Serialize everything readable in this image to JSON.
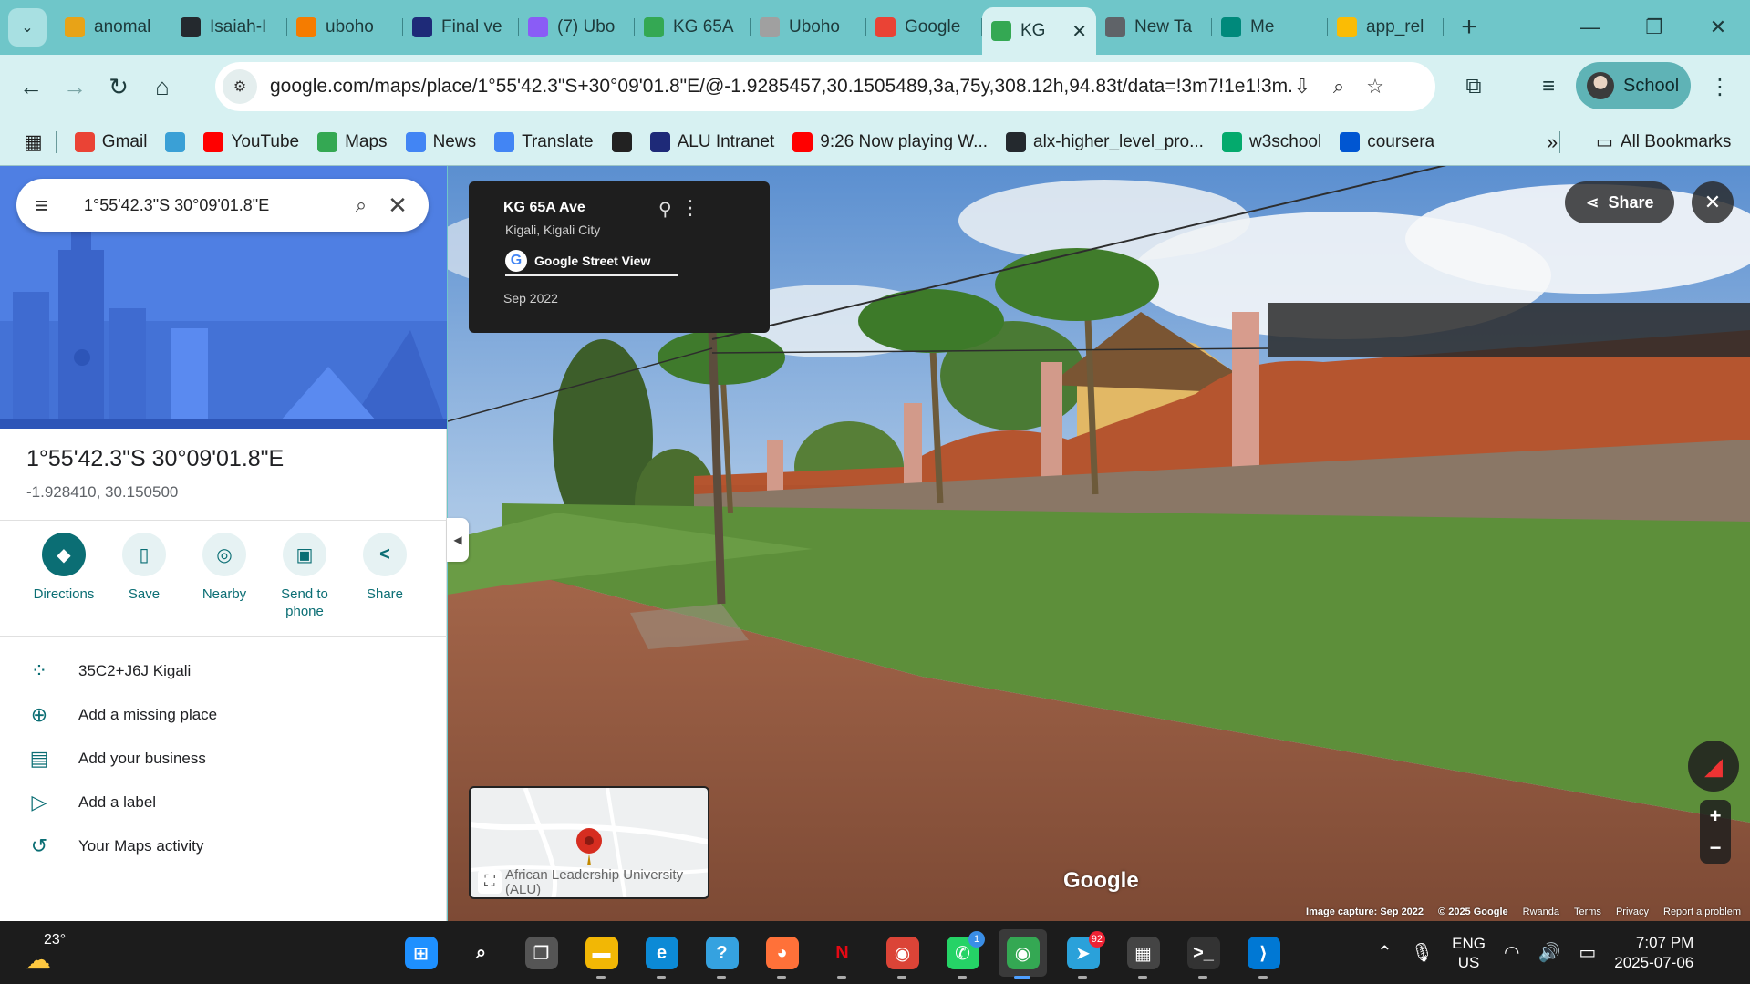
{
  "browser": {
    "tabs": [
      {
        "label": "anomal",
        "icon": "folder-icon",
        "color": "#e8a317"
      },
      {
        "label": "Isaiah-I",
        "icon": "github-icon",
        "color": "#24292e"
      },
      {
        "label": "uboho",
        "icon": "firebase-icon",
        "color": "#f57c00"
      },
      {
        "label": "Final ve",
        "icon": "alu-icon",
        "color": "#1e2a78"
      },
      {
        "label": "(7) Ubo",
        "icon": "vercel-icon",
        "color": "#8a5cf6"
      },
      {
        "label": "KG 65A",
        "icon": "maps-icon",
        "color": "#34a853"
      },
      {
        "label": "Uboho",
        "icon": "loading-icon",
        "color": "#a0a0a0"
      },
      {
        "label": "Google",
        "icon": "gmail-icon",
        "color": "#ea4335"
      },
      {
        "label": "KG",
        "icon": "maps-icon",
        "color": "#34a853",
        "active": true
      },
      {
        "label": "New Ta",
        "icon": "chrome-icon",
        "color": "#5f6368"
      },
      {
        "label": "Me",
        "icon": "meet-icon",
        "color": "#00897b"
      },
      {
        "label": "app_rel",
        "icon": "drive-icon",
        "color": "#fbbc04"
      }
    ],
    "url": "google.com/maps/place/1°55'42.3\"S+30°09'01.8\"E/@-1.9285457,30.1505489,3a,75y,308.12h,94.83t/data=!3m7!1e1!3m...",
    "profile_label": "School",
    "bookmarks": [
      {
        "label": "Gmail",
        "icon": "gmail-icon",
        "color": "#ea4335"
      },
      {
        "label": "",
        "icon": "box-icon",
        "color": "#3aa0d6"
      },
      {
        "label": "YouTube",
        "icon": "youtube-icon",
        "color": "#ff0000"
      },
      {
        "label": "Maps",
        "icon": "maps-icon",
        "color": "#34a853"
      },
      {
        "label": "News",
        "icon": "news-icon",
        "color": "#4285f4"
      },
      {
        "label": "Translate",
        "icon": "translate-icon",
        "color": "#4285f4"
      },
      {
        "label": "",
        "icon": "globe-icon",
        "color": "#222222"
      },
      {
        "label": "ALU Intranet",
        "icon": "alu-icon",
        "color": "#1e2a78"
      },
      {
        "label": "9:26 Now playing W...",
        "icon": "youtube-icon",
        "color": "#ff0000"
      },
      {
        "label": "alx-higher_level_pro...",
        "icon": "github-icon",
        "color": "#24292e"
      },
      {
        "label": "w3school",
        "icon": "w3-icon",
        "color": "#04aa6d"
      },
      {
        "label": "coursera",
        "icon": "coursera-icon",
        "color": "#0056d2"
      }
    ],
    "all_bookmarks_label": "All Bookmarks"
  },
  "maps": {
    "search_value": "1°55'42.3\"S 30°09'01.8\"E",
    "place_title": "1°55'42.3\"S 30°09'01.8\"E",
    "place_coords": "-1.928410, 30.150500",
    "actions": [
      {
        "label": "Directions",
        "icon": "directions-icon",
        "glyph": "◆",
        "primary": true
      },
      {
        "label": "Save",
        "icon": "bookmark-icon",
        "glyph": "▯"
      },
      {
        "label": "Nearby",
        "icon": "nearby-icon",
        "glyph": "◎"
      },
      {
        "label": "Send to phone",
        "icon": "phone-icon",
        "glyph": "▣"
      },
      {
        "label": "Share",
        "icon": "share-icon",
        "glyph": "<"
      }
    ],
    "details": [
      {
        "label": "35C2+J6J Kigali",
        "icon": "plus-code-icon",
        "glyph": "⁘"
      },
      {
        "label": "Add a missing place",
        "icon": "add-place-icon",
        "glyph": "⊕"
      },
      {
        "label": "Add your business",
        "icon": "add-business-icon",
        "glyph": "▤"
      },
      {
        "label": "Add a label",
        "icon": "label-icon",
        "glyph": "▷"
      },
      {
        "label": "Your Maps activity",
        "icon": "history-icon",
        "glyph": "↺"
      }
    ]
  },
  "streetview": {
    "street": "KG 65A Ave",
    "city": "Kigali, Kigali City",
    "badge": "Google Street View",
    "date": "Sep 2022",
    "share_label": "Share",
    "minimap_label": "African Leadership University (ALU)",
    "watermark": "Google",
    "footer": [
      "Image capture: Sep 2022",
      "© 2025 Google",
      "Rwanda",
      "Terms",
      "Privacy",
      "Report a problem"
    ]
  },
  "taskbar": {
    "temperature": "23°",
    "apps": [
      {
        "icon": "windows-start-icon",
        "color": "#1e90ff",
        "glyph": "⊞"
      },
      {
        "icon": "search-icon",
        "color": "#1c1c1c",
        "glyph": "⌕"
      },
      {
        "icon": "task-view-icon",
        "color": "#555555",
        "glyph": "❐"
      },
      {
        "icon": "file-explorer-icon",
        "color": "#f2b705",
        "glyph": "▬"
      },
      {
        "icon": "edge-icon",
        "color": "#0c8ad6",
        "glyph": "e"
      },
      {
        "icon": "copilot-icon",
        "color": "#35a2e0",
        "glyph": "?"
      },
      {
        "icon": "firefox-icon",
        "color": "#ff7139",
        "glyph": "◕"
      },
      {
        "icon": "netflix-icon",
        "color": "#1c1c1c",
        "glyph": "N",
        "text_color": "#e50914"
      },
      {
        "icon": "chrome-icon",
        "color": "#db4437",
        "glyph": "◉"
      },
      {
        "icon": "whatsapp-icon",
        "color": "#25d366",
        "glyph": "✆",
        "badge": "1",
        "badge_blue": true
      },
      {
        "icon": "chrome-profile-icon",
        "color": "#34a853",
        "glyph": "◉",
        "active": true
      },
      {
        "icon": "telegram-icon",
        "color": "#2aa1da",
        "glyph": "➤",
        "badge": "92"
      },
      {
        "icon": "calculator-icon",
        "color": "#444444",
        "glyph": "▦"
      },
      {
        "icon": "terminal-icon",
        "color": "#333333",
        "glyph": ">_"
      },
      {
        "icon": "vscode-icon",
        "color": "#0078d4",
        "glyph": "⟩"
      }
    ],
    "lang_line1": "ENG",
    "lang_line2": "US",
    "time": "7:07 PM",
    "date": "2025-07-06"
  }
}
